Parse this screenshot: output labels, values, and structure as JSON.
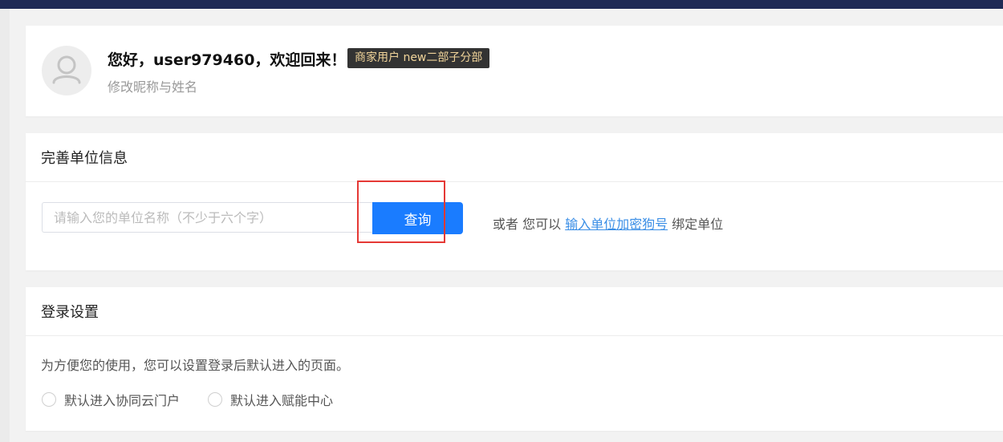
{
  "profile": {
    "greeting": "您好，user979460，欢迎回来！",
    "badge": "商家用户 new二部子分部",
    "edit_link": "修改昵称与姓名",
    "avatar_icon": "user-avatar-icon"
  },
  "org": {
    "title": "完善单位信息",
    "input_placeholder": "请输入您的单位名称（不少于六个字）",
    "input_value": "",
    "query_label": "查询",
    "alt_prefix": "或者 您可以",
    "alt_link": "输入单位加密狗号",
    "alt_suffix": "绑定单位"
  },
  "login": {
    "title": "登录设置",
    "description": "为方便您的使用，您可以设置登录后默认进入的页面。",
    "options": [
      {
        "label": "默认进入协同云门户",
        "checked": false
      },
      {
        "label": "默认进入赋能中心",
        "checked": false
      }
    ]
  },
  "colors": {
    "topbar": "#1f2a55",
    "primary": "#1a7cff",
    "highlight": "#e53935",
    "badge_bg": "#333333",
    "badge_text": "#f1d49a",
    "link": "#3a8ee6"
  }
}
